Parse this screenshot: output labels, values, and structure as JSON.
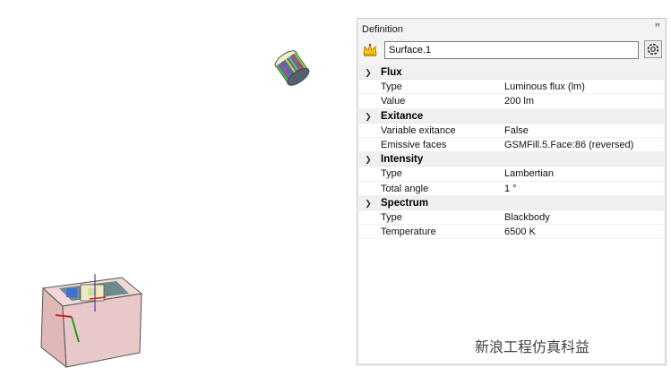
{
  "panel": {
    "title": "Definition",
    "pin_glyph": "ꟸ",
    "name_value": "Surface.1",
    "icons": {
      "source": "crown-icon",
      "settings": "gear-icon",
      "pin": "pin-icon",
      "collapse": "chevron-down-icon"
    },
    "categories": [
      {
        "label": "Flux",
        "props": [
          {
            "name": "Type",
            "value": "Luminous flux (lm)"
          },
          {
            "name": "Value",
            "value": "200 lm"
          }
        ]
      },
      {
        "label": "Exitance",
        "props": [
          {
            "name": "Variable exitance",
            "value": "False"
          },
          {
            "name": "Emissive faces",
            "value": "GSMFill.5.Face:86 (reversed)"
          }
        ]
      },
      {
        "label": "Intensity",
        "props": [
          {
            "name": "Type",
            "value": "Lambertian"
          },
          {
            "name": "Total angle",
            "value": "1 °"
          }
        ]
      },
      {
        "label": "Spectrum",
        "props": [
          {
            "name": "Type",
            "value": "Blackbody"
          },
          {
            "name": "Temperature",
            "value": "6500 K"
          }
        ]
      }
    ]
  },
  "watermark": {
    "text": "新浪工程仿真科益"
  },
  "colors": {
    "panel_bg": "#f3f3f3",
    "category_bg": "#f0f0f0",
    "model_body": "#e8c8c8"
  }
}
